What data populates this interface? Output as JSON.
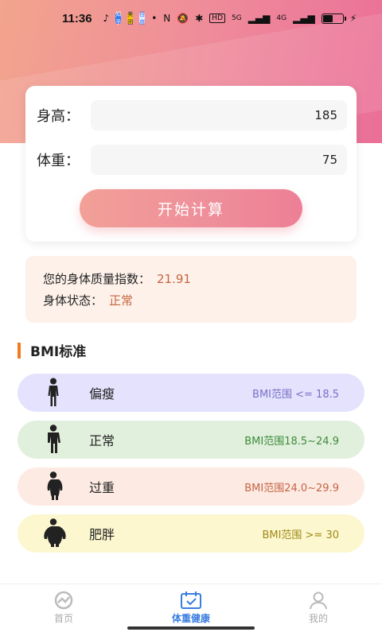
{
  "status_bar": {
    "time": "11:36",
    "badges": [
      "知乎",
      "美团",
      "百度"
    ],
    "network": "5G",
    "network2": "4G",
    "battery_level": 0.55
  },
  "form": {
    "height_label": "身高：",
    "height_value": "185",
    "weight_label": "体重：",
    "weight_value": "75",
    "calc_button": "开始计算"
  },
  "result": {
    "bmi_label": "您的身体质量指数：",
    "bmi_value": "21.91",
    "status_label": "身体状态：",
    "status_value": "正常"
  },
  "section": {
    "title": "BMI标准"
  },
  "categories": [
    {
      "name": "偏瘦",
      "range": "BMI范围 <= 18.5",
      "bg": "#e4e2fc",
      "color": "#7a70c8",
      "icon": "thin-person-icon"
    },
    {
      "name": "正常",
      "range": "BMI范围18.5~24.9",
      "bg": "#e1f0dc",
      "color": "#3d8a3c",
      "icon": "normal-person-icon"
    },
    {
      "name": "过重",
      "range": "BMI范围24.0~29.9",
      "bg": "#fdebe3",
      "color": "#c46445",
      "icon": "overweight-person-icon"
    },
    {
      "name": "肥胖",
      "range": "BMI范围 >= 30",
      "bg": "#fcf7cf",
      "color": "#a08a18",
      "icon": "obese-person-icon"
    }
  ],
  "tabs": [
    {
      "label": "首页",
      "active": false
    },
    {
      "label": "体重健康",
      "active": true
    },
    {
      "label": "我的",
      "active": false
    }
  ],
  "colors": {
    "accent": "#3a7de0",
    "result_value": "#c7653f",
    "section_bar": "#f07a1d"
  }
}
